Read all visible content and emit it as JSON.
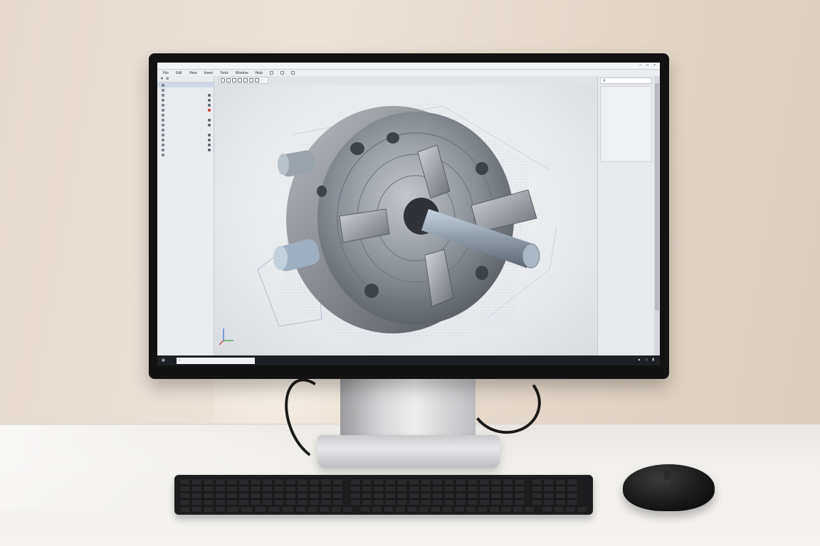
{
  "scene": {
    "colors": {
      "wall": "#e8ddd1",
      "desk": "#f1efec",
      "bezel": "#121212",
      "stand": "#d6d6d8",
      "keyboard": "#1d1d1f",
      "mouse": "#1a1a1a",
      "metal_part": "#9aa0a8"
    }
  },
  "app": {
    "window_title": "",
    "menu_items": [
      "File",
      "Edit",
      "View",
      "Insert",
      "Tools",
      "Window",
      "Help"
    ],
    "toolbar_icons": [
      "select-icon",
      "rotate-icon",
      "pan-icon",
      "zoom-icon",
      "section-icon",
      "measure-icon",
      "fit-icon"
    ]
  },
  "left_panel": {
    "header_icon": "filter-icon",
    "items": [
      {
        "label": "",
        "icon": "part-icon"
      },
      {
        "label": "",
        "icon": "origin-icon"
      },
      {
        "label": "",
        "icon": "feature-icon"
      },
      {
        "label": "",
        "icon": "feature-icon"
      },
      {
        "label": "",
        "icon": "feature-icon"
      },
      {
        "label": "",
        "icon": "feature-icon"
      },
      {
        "label": "",
        "icon": "feature-icon"
      },
      {
        "label": "",
        "icon": "feature-icon"
      },
      {
        "label": "",
        "icon": "feature-icon"
      },
      {
        "label": "",
        "icon": "feature-icon"
      },
      {
        "label": "",
        "icon": "feature-icon"
      },
      {
        "label": "",
        "icon": "feature-icon"
      },
      {
        "label": "",
        "icon": "feature-icon"
      },
      {
        "label": "",
        "icon": "feature-icon"
      },
      {
        "label": "",
        "icon": "feature-icon"
      }
    ]
  },
  "right_panel": {
    "search_icon": "search-icon",
    "items": [
      "",
      "",
      "",
      "",
      "",
      "",
      "",
      "",
      "",
      "",
      "",
      "",
      "",
      "",
      ""
    ]
  },
  "viewport": {
    "model": "four-jaw-lathe-chuck",
    "axis_triad_icon": "axis-triad-icon"
  },
  "taskbar": {
    "start_icon": "start-icon",
    "search_placeholder": "",
    "tray_icons": [
      "network-icon",
      "volume-icon",
      "battery-icon"
    ]
  }
}
